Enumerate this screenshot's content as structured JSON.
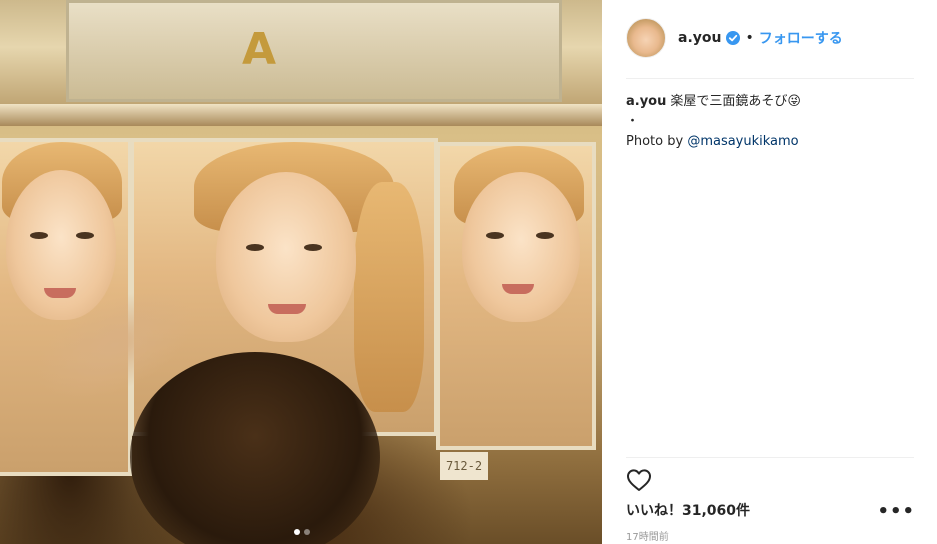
{
  "post": {
    "image_alt_icon": "photo",
    "carousel": {
      "count": 2,
      "active_index": 0
    },
    "sticker_text": "712-2"
  },
  "header": {
    "username": "a.you",
    "separator": "•",
    "follow_label": "フォローする",
    "verified_icon": "verified-badge-icon",
    "accent": "#3897f0"
  },
  "caption": {
    "username": "a.you",
    "text": "楽屋で三面鏡あそび😜",
    "bullet": "・",
    "photo_credit_prefix": "Photo by",
    "mention": "@masayukikamo"
  },
  "actions": {
    "like_icon": "heart-outline-icon",
    "more_icon": "more-dots-icon",
    "more_label": "•••"
  },
  "likes": {
    "label": "いいね！31,060件"
  },
  "timestamp": "17時間前"
}
